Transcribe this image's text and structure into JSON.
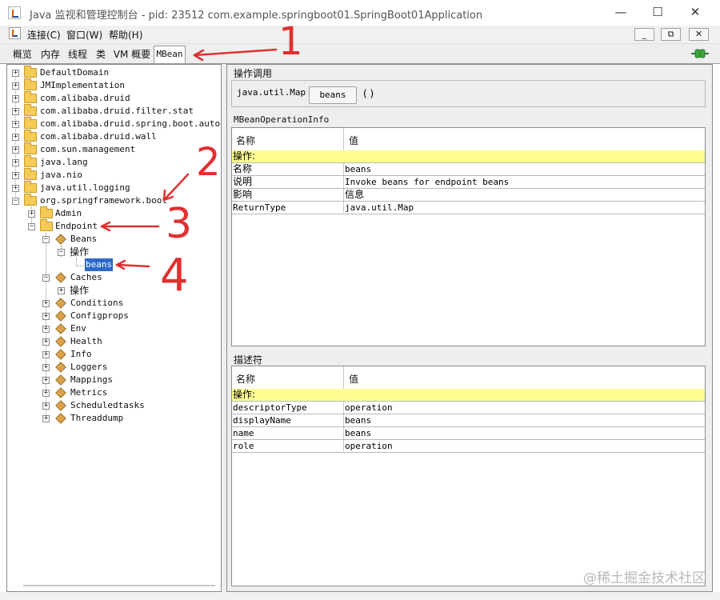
{
  "window": {
    "title": "Java 监视和管理控制台 - pid: 23512 com.example.springboot01.SpringBoot01Application",
    "minimize_glyph": "—",
    "maximize_glyph": "☐",
    "close_glyph": "✕"
  },
  "menu": {
    "items": [
      "连接(C)",
      "窗口(W)",
      "帮助(H)"
    ],
    "mdi_buttons": [
      "_",
      "⧉",
      "✕"
    ]
  },
  "tabs": {
    "items": [
      "概览",
      "内存",
      "线程",
      "类",
      "VM 概要",
      "MBean"
    ],
    "active": "MBean"
  },
  "tree": {
    "domains": [
      "DefaultDomain",
      "JMImplementation",
      "com.alibaba.druid",
      "com.alibaba.druid.filter.stat",
      "com.alibaba.druid.spring.boot.autoconf",
      "com.alibaba.druid.wall",
      "com.sun.management",
      "java.lang",
      "java.nio",
      "java.util.logging",
      "org.springframework.boot"
    ],
    "boot_children": [
      "Admin",
      "Endpoint"
    ],
    "endpoint_beans_label": "Beans",
    "operations_label": "操作",
    "selected_leaf": "beans",
    "caches_label": "Caches",
    "caches_ops_label": "操作",
    "endpoint_rest": [
      "Conditions",
      "Configprops",
      "Env",
      "Health",
      "Info",
      "Loggers",
      "Mappings",
      "Metrics",
      "Scheduledtasks",
      "Threaddump"
    ]
  },
  "operation": {
    "section_title": "操作调用",
    "return_type": "java.util.Map",
    "button_label": "beans",
    "params": "( )"
  },
  "info_table": {
    "section_title": "MBeanOperationInfo",
    "headers": [
      "名称",
      "值"
    ],
    "group_label": "操作:",
    "rows": [
      [
        "名称",
        "beans"
      ],
      [
        "说明",
        "Invoke beans for endpoint beans"
      ],
      [
        "影响",
        "信息"
      ],
      [
        "ReturnType",
        "java.util.Map"
      ]
    ]
  },
  "descriptor_table": {
    "section_title": "描述符",
    "headers": [
      "名称",
      "值"
    ],
    "group_label": "操作:",
    "rows": [
      [
        "descriptorType",
        "operation"
      ],
      [
        "displayName",
        "beans"
      ],
      [
        "name",
        "beans"
      ],
      [
        "role",
        "operation"
      ]
    ]
  },
  "annotations": {
    "marks": [
      "1",
      "2",
      "3",
      "4"
    ],
    "color": "#e03030"
  },
  "watermark": "@稀土掘金技术社区",
  "colors": {
    "selection": "#2d69c5",
    "group_row": "#fefe90",
    "connection_icon": "#3aa83a"
  }
}
